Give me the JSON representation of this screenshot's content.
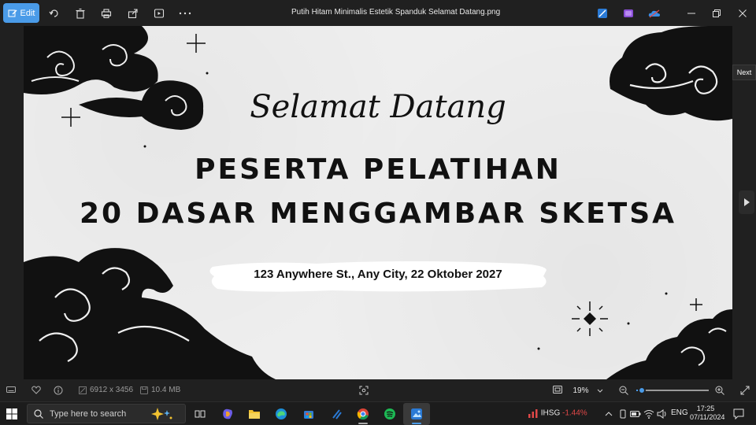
{
  "window": {
    "title": "Putih Hitam Minimalis Estetik Spanduk Selamat Datang.png",
    "edit_label": "Edit",
    "next_label": "Next"
  },
  "toolbar": {
    "icons": [
      "edit-icon",
      "rotate-icon",
      "delete-icon",
      "print-icon",
      "share-icon",
      "slideshow-icon",
      "more-icon"
    ],
    "right_icons": [
      "designer-icon",
      "clipchamp-icon",
      "onedrive-icon"
    ]
  },
  "banner": {
    "greeting": "Selamat Datang",
    "line1": "PESERTA PELATIHAN",
    "line2": "20 DASAR MENGGAMBAR SKETSA",
    "address": "123 Anywhere St., Any City, 22 Oktober 2027"
  },
  "statusbar": {
    "dimensions": "6912 x 3456",
    "file_size": "10.4 MB",
    "zoom": "19%",
    "zoom_fraction": 0.08
  },
  "taskbar": {
    "search_placeholder": "Type here to search",
    "stock_name": "IHSG",
    "stock_change": "-1.44%",
    "language": "ENG",
    "time": "17:25",
    "date": "07/11/2024"
  },
  "colors": {
    "accent": "#4a9be8",
    "stock_down": "#e04848"
  }
}
